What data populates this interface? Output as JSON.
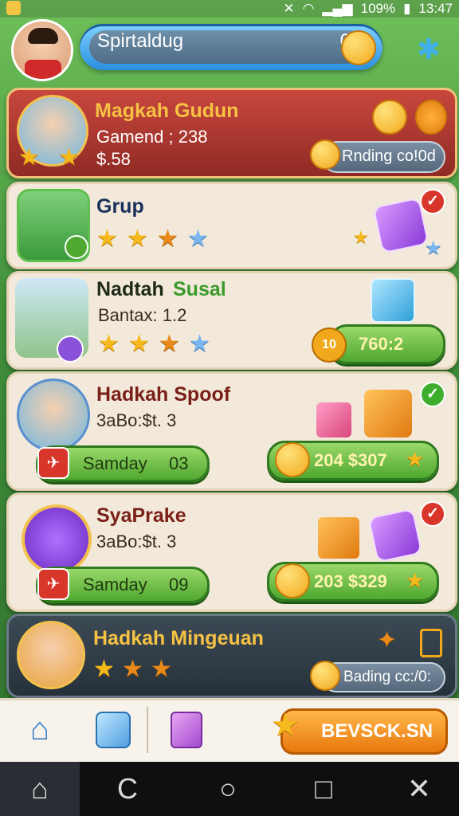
{
  "status": {
    "battery": "109%",
    "time": "13:47"
  },
  "header": {
    "search_text": "Spirtaldug",
    "counter": "0"
  },
  "cards": [
    {
      "title": "Magkah Gudun",
      "line1": "Gamend ; 238",
      "line2": "$.58",
      "badge": "Rnding co!0d",
      "theme": "#b53a33"
    },
    {
      "title": "Grup",
      "theme": "#f0e6d6"
    },
    {
      "title_a": "Nadtah ",
      "title_b": "Susal",
      "line1": "Bantax: 1.2",
      "value": "760:2",
      "tag": "10"
    },
    {
      "title": "Hadkah Spoof",
      "line1": "3aBo:$t. 3",
      "day": "Samday",
      "day_num": "03",
      "reward": "204 $307"
    },
    {
      "title": "SyaPrake",
      "line1": "3aBo:$t. 3",
      "day": "Samday",
      "day_num": "09",
      "reward": "203 $329"
    },
    {
      "title": "Hadkah Mingeuan",
      "badge": "Bading cc:/0:"
    }
  ],
  "bottom": {
    "action": "BEVSCK.SN"
  },
  "icons": [
    "signal-icon",
    "wifi-icon",
    "battery-icon",
    "pet-icon",
    "home-icon",
    "cube-icon",
    "note-icon",
    "star-icon",
    "back-icon",
    "circle-icon",
    "square-icon",
    "close-icon"
  ]
}
